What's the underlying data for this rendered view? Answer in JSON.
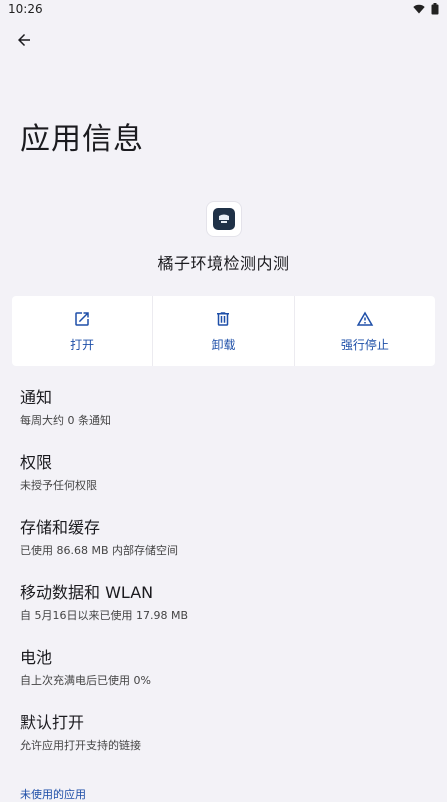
{
  "status_bar": {
    "time": "10:26"
  },
  "page": {
    "title": "应用信息"
  },
  "app": {
    "name": "橘子环境检测内测"
  },
  "actions": [
    {
      "label": "打开",
      "icon": "open-external-icon"
    },
    {
      "label": "卸载",
      "icon": "trash-icon"
    },
    {
      "label": "强行停止",
      "icon": "warning-icon"
    }
  ],
  "settings": [
    {
      "title": "通知",
      "summary": "每周大约 0 条通知"
    },
    {
      "title": "权限",
      "summary": "未授予任何权限"
    },
    {
      "title": "存储和缓存",
      "summary": "已使用 86.68 MB 内部存储空间"
    },
    {
      "title": "移动数据和 WLAN",
      "summary": "自 5月16日以来已使用 17.98 MB"
    },
    {
      "title": "电池",
      "summary": "自上次充满电后已使用 0%"
    },
    {
      "title": "默认打开",
      "summary": "允许应用打开支持的链接"
    }
  ],
  "section": {
    "unused_apps": "未使用的应用"
  },
  "colors": {
    "accent": "#1e4fa8",
    "background": "#f3f2f7"
  }
}
